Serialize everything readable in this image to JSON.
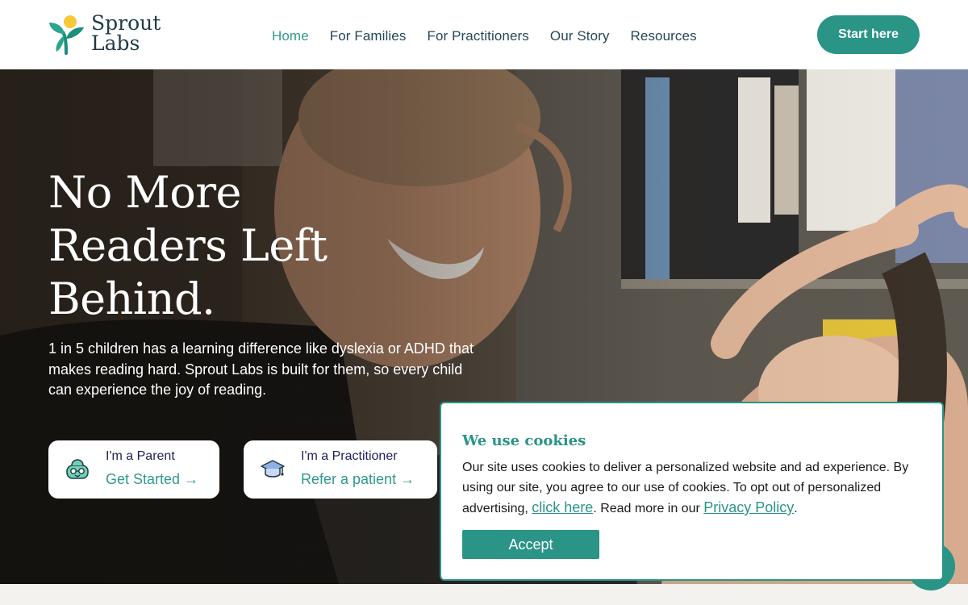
{
  "header": {
    "logo_line1": "Sprout",
    "logo_line2": "Labs",
    "nav": [
      {
        "label": "Home",
        "active": true
      },
      {
        "label": "For Families"
      },
      {
        "label": "For Practitioners"
      },
      {
        "label": "Our Story"
      },
      {
        "label": "Resources"
      }
    ],
    "cta_label": "Start here"
  },
  "hero": {
    "headline_line1": "No More",
    "headline_line2": "Readers Left",
    "headline_line3": "Behind.",
    "subtext": "1 in 5 children has a learning difference like dyslexia or ADHD that makes reading hard. Sprout Labs is built for them, so every child can experience the joy of reading.",
    "cards": [
      {
        "title": "I'm a Parent",
        "link": "Get Started →",
        "icon": "child-face-icon"
      },
      {
        "title": "I'm a Practitioner",
        "link": "Refer a patient →",
        "icon": "graduation-cap-icon"
      }
    ]
  },
  "cookie": {
    "title": "We use cookies",
    "text_before": "Our site uses cookies to deliver a personalized website and ad experience. By using our site, you agree to our use of cookies. To opt out of personalized advertising, ",
    "link1": "click here",
    "text_middle": ". Read more in our ",
    "link2": "Privacy Policy",
    "text_after": ".",
    "accept_label": "Accept"
  },
  "colors": {
    "brand": "#2a9486",
    "nav_text": "#24485a",
    "card_title": "#21205a",
    "logo_yellow": "#f6c83a"
  }
}
